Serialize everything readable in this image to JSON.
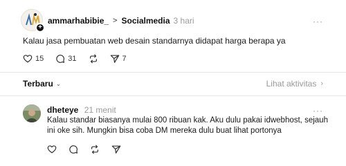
{
  "post": {
    "username": "ammarhabibie_",
    "separator": ">",
    "community": "Socialmedia",
    "time": "3 hari",
    "more": "···",
    "text": "Kalau jasa pembuatan web desain standarnya didapat harga berapa ya",
    "actions": {
      "likes": "15",
      "comments": "31",
      "reposts": "",
      "shares": "7"
    }
  },
  "sort": {
    "label": "Terbaru",
    "activity_label": "Lihat aktivitas"
  },
  "comment": {
    "username": "dheteye",
    "time": "21 menit",
    "more": "···",
    "text": "Kalau standar biasanya mulai 800 ribuan kak. Aku dulu pakai idwebhost, sejauh ini oke sih. Mungkin bisa coba DM mereka dulu buat lihat portonya"
  },
  "icons": {
    "like": "heart-icon",
    "comment": "comment-icon",
    "repost": "repost-icon",
    "share": "send-icon",
    "plus": "plus-icon"
  }
}
